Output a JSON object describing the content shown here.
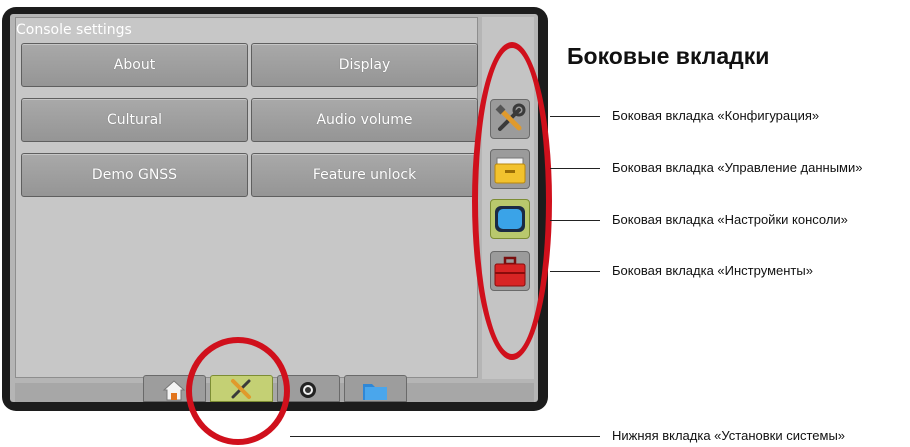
{
  "panel": {
    "title": "Console settings",
    "buttons": [
      "About",
      "Display",
      "Cultural",
      "Audio volume",
      "Demo GNSS",
      "Feature unlock"
    ]
  },
  "side_tabs": [
    "configuration-icon",
    "data-management-icon",
    "console-settings-icon",
    "tools-icon"
  ],
  "bottom_tabs": [
    "home-icon",
    "system-setup-icon",
    "guidance-icon",
    "folder-icon"
  ],
  "annotations": {
    "heading": "Боковые вкладки",
    "side_config": "Боковая вкладка «Конфигурация»",
    "side_data": "Боковая вкладка «Управление данными»",
    "side_console": "Боковая вкладка «Настройки консоли»",
    "side_tools": "Боковая вкладка «Инструменты»",
    "bottom_system": "Нижняя вкладка «Установки системы»"
  },
  "colors": {
    "highlight": "#d0101c",
    "active_tab": "#b9c86d"
  }
}
